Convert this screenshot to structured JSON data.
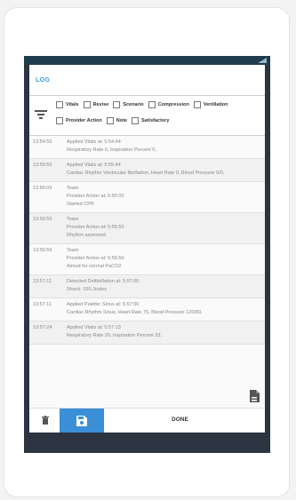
{
  "dialog": {
    "title": "LOG",
    "filters_row1": [
      "Vitals",
      "Revise",
      "Scenario",
      "Compression",
      "Ventilation"
    ],
    "filters_row2": [
      "Provider Action",
      "Note",
      "Satisfactory"
    ]
  },
  "log": [
    {
      "time": "13:54:55",
      "lines": [
        "Applied Vitals at: 5:54:44",
        "Respiratory Rate 0, Inspiration Percent 0,"
      ]
    },
    {
      "time": "13:55:55",
      "lines": [
        "Applied Vitals at: 5:55:44",
        "Cardiac Rhythm Ventricular fibrillation, Heart Rate 0, Blood Pressure 0/0,"
      ]
    },
    {
      "time": "13:56:09",
      "lines": [
        "Team",
        "Provider Action at: 5:55:00",
        "Started CPR"
      ]
    },
    {
      "time": "13:56:59",
      "lines": [
        "Team",
        "Provider Action at: 5:55:50",
        "Rhythm assessed"
      ]
    },
    {
      "time": "13:56:59",
      "lines": [
        "Team",
        "Provider Action at: 5:55:50",
        "Aimed for normal PaCO2"
      ]
    },
    {
      "time": "13:57:11",
      "lines": [
        "Detected Defibrillation at: 5:57:00",
        "Shock: 150 Joules"
      ]
    },
    {
      "time": "13:57:11",
      "lines": [
        "Applied Palette: Sinus at: 5:57:00",
        "Cardiac Rhythm Sinus, Heart Rate 75, Blood Pressure 120/80,"
      ]
    },
    {
      "time": "13:57:24",
      "lines": [
        "Applied Vitals at: 5:57:13",
        "Respiratory Rate 20, Inspiration Percent 33,"
      ]
    }
  ],
  "bottom": {
    "done_label": "DONE"
  },
  "colors": {
    "accent": "#3a8fd6",
    "title": "#3a9ad9",
    "statusbar": "#1e3c4e"
  },
  "icons": {
    "filter": "filter-icon",
    "export": "export-document-icon",
    "trash": "trash-icon",
    "save": "save-icon"
  }
}
